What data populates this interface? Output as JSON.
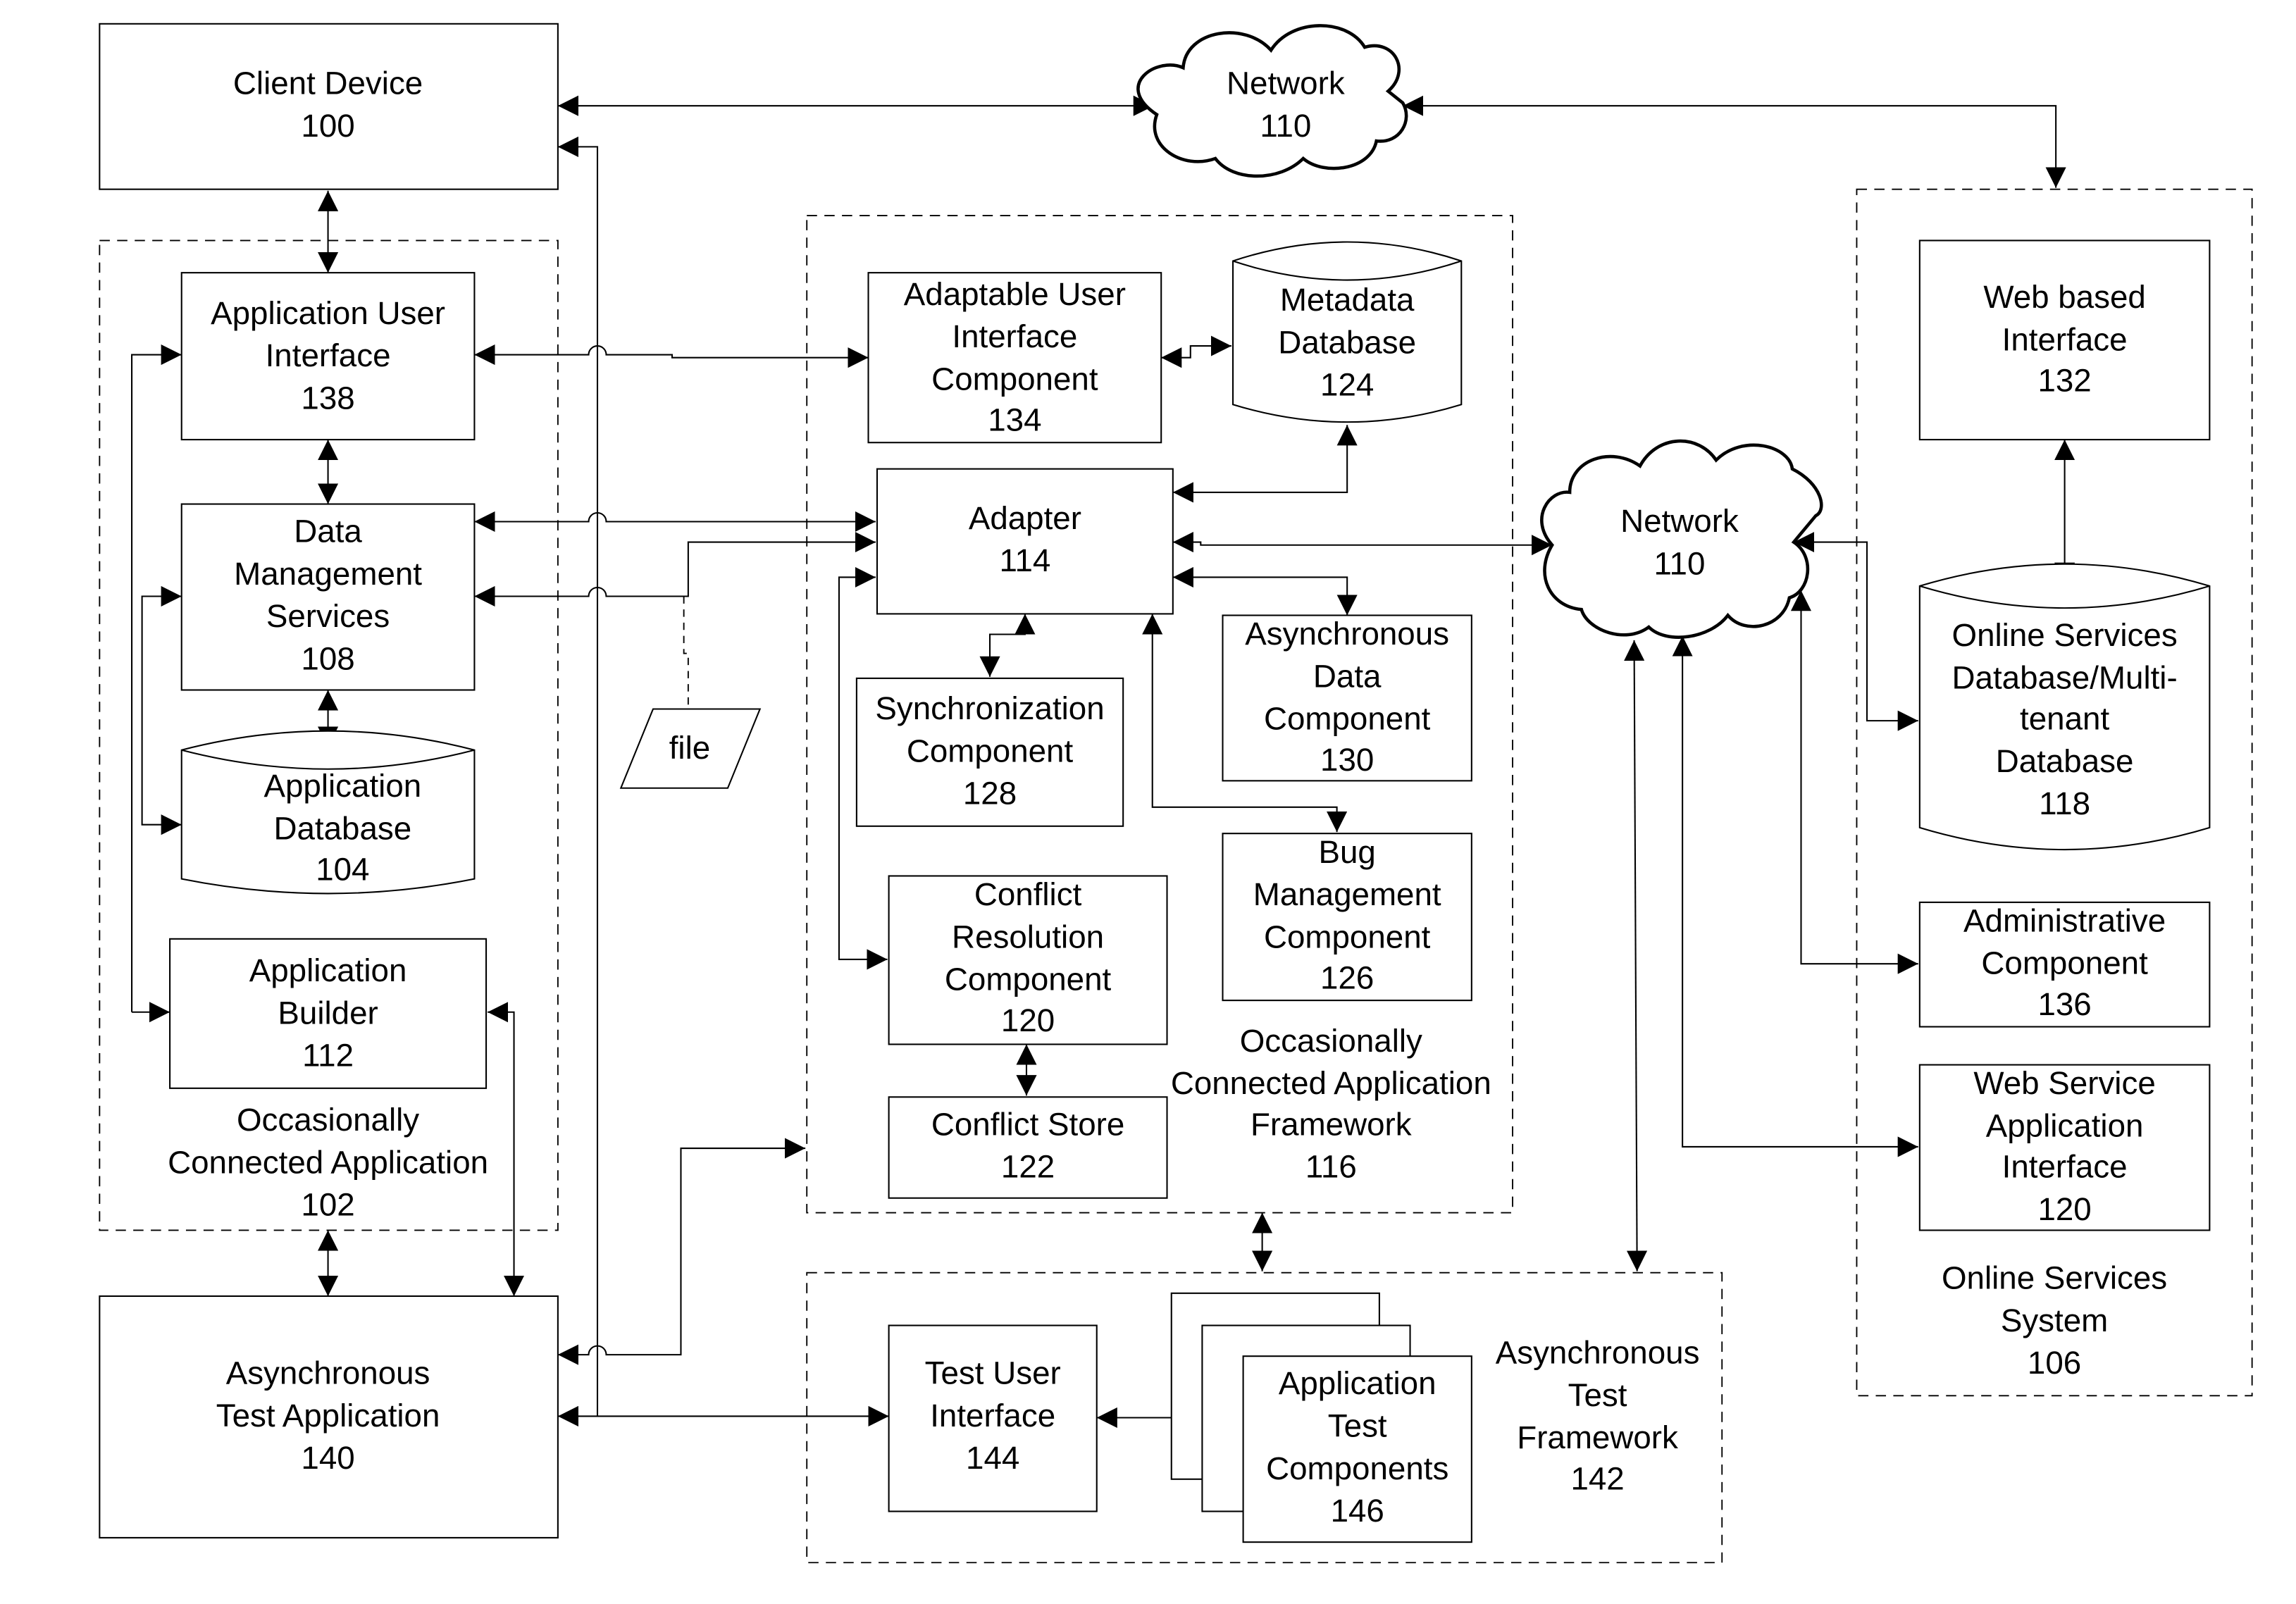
{
  "diagram": {
    "type": "system-architecture",
    "nodes": {
      "client_device": {
        "lines": [
          "Client Device",
          "100"
        ]
      },
      "network_top": {
        "lines": [
          "Network",
          "110"
        ]
      },
      "network_mid": {
        "lines": [
          "Network",
          "110"
        ]
      },
      "app_ui": {
        "lines": [
          "Application User",
          "Interface",
          "138"
        ]
      },
      "data_mgmt": {
        "lines": [
          "Data",
          "Management",
          "Services",
          "108"
        ]
      },
      "app_db": {
        "lines": [
          "Application",
          "Database",
          "104"
        ]
      },
      "app_builder": {
        "lines": [
          "Application",
          "Builder",
          "112"
        ]
      },
      "oca_label": {
        "lines": [
          "Occasionally",
          "Connected Application",
          "102"
        ]
      },
      "async_test_app": {
        "lines": [
          "Asynchronous",
          "Test Application",
          "140"
        ]
      },
      "file": {
        "lines": [
          "file"
        ]
      },
      "adaptable_ui": {
        "lines": [
          "Adaptable User",
          "Interface",
          "Component",
          "134"
        ]
      },
      "metadata_db": {
        "lines": [
          "Metadata",
          "Database",
          "124"
        ]
      },
      "adapter": {
        "lines": [
          "Adapter",
          "114"
        ]
      },
      "sync_comp": {
        "lines": [
          "Synchronization",
          "Component",
          "128"
        ]
      },
      "async_data": {
        "lines": [
          "Asynchronous",
          "Data",
          "Component",
          "130"
        ]
      },
      "conflict_res": {
        "lines": [
          "Conflict",
          "Resolution",
          "Component",
          "120"
        ]
      },
      "bug_mgmt": {
        "lines": [
          "Bug",
          "Management",
          "Component",
          "126"
        ]
      },
      "conflict_store": {
        "lines": [
          "Conflict Store",
          "122"
        ]
      },
      "ocaf_label": {
        "lines": [
          "Occasionally",
          "Connected Application",
          "Framework",
          "116"
        ]
      },
      "web_ui": {
        "lines": [
          "Web based",
          "Interface",
          "132"
        ]
      },
      "online_db": {
        "lines": [
          "Online Services",
          "Database/Multi-",
          "tenant",
          "Database",
          "118"
        ]
      },
      "admin_comp": {
        "lines": [
          "Administrative",
          "Component",
          "136"
        ]
      },
      "ws_api": {
        "lines": [
          "Web Service",
          "Application",
          "Interface",
          "120"
        ]
      },
      "oss_label": {
        "lines": [
          "Online Services",
          "System",
          "106"
        ]
      },
      "test_ui": {
        "lines": [
          "Test User",
          "Interface",
          "144"
        ]
      },
      "app_test_comp": {
        "lines": [
          "Application",
          "Test",
          "Components",
          "146"
        ]
      },
      "atf_label": {
        "lines": [
          "Asynchronous",
          "Test",
          "Framework",
          "142"
        ]
      }
    }
  }
}
